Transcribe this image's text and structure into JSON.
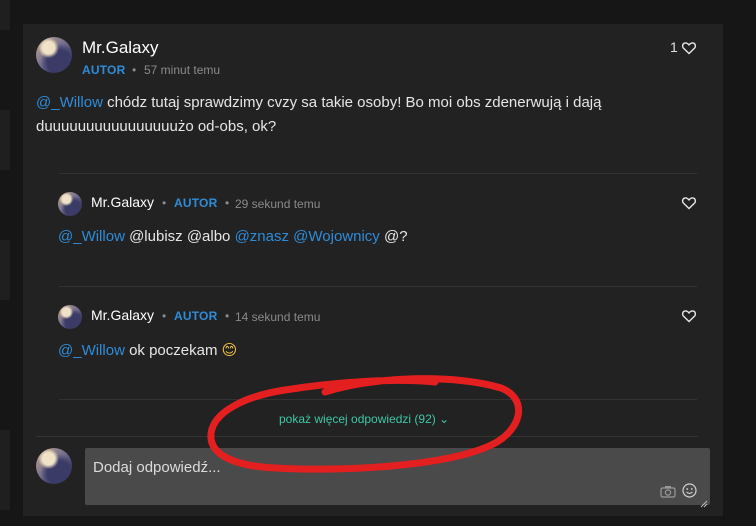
{
  "post": {
    "author": "Mr.Galaxy",
    "badge": "AUTOR",
    "separator": "•",
    "time": "57 minut temu",
    "likes": "1",
    "mention": "@_Willow",
    "text_line1": " chódz tutaj sprawdzimy cvzy sa takie osoby! Bo moi obs zdenerwują i dają",
    "text_line2": "duuuuuuuuuuuuuuuużo od-obs, ok?"
  },
  "replies": [
    {
      "author": "Mr.Galaxy",
      "badge": "AUTOR",
      "time": "29 sekund temu",
      "m1": "@_Willow",
      "t1": " @lubisz @albo ",
      "m2": "@znasz",
      "t2": " ",
      "m3": "@Wojownicy",
      "t3": " @?"
    },
    {
      "author": "Mr.Galaxy",
      "badge": "AUTOR",
      "time": "14 sekund temu",
      "m1": "@_Willow",
      "t1": " ok poczekam ",
      "emoji": "😊"
    }
  ],
  "more_replies": "pokaż więcej odpowiedzi (92) ⌄",
  "reply_input": {
    "placeholder": "Dodaj odpowiedź..."
  },
  "colors": {
    "mention": "#2f8cd8",
    "badge": "#2f8cd8",
    "more_link": "#3fc7a5",
    "annotation": "#e41f1f"
  },
  "icons": [
    "heart-icon",
    "camera-icon",
    "emoji-icon",
    "resize-handle-icon"
  ]
}
